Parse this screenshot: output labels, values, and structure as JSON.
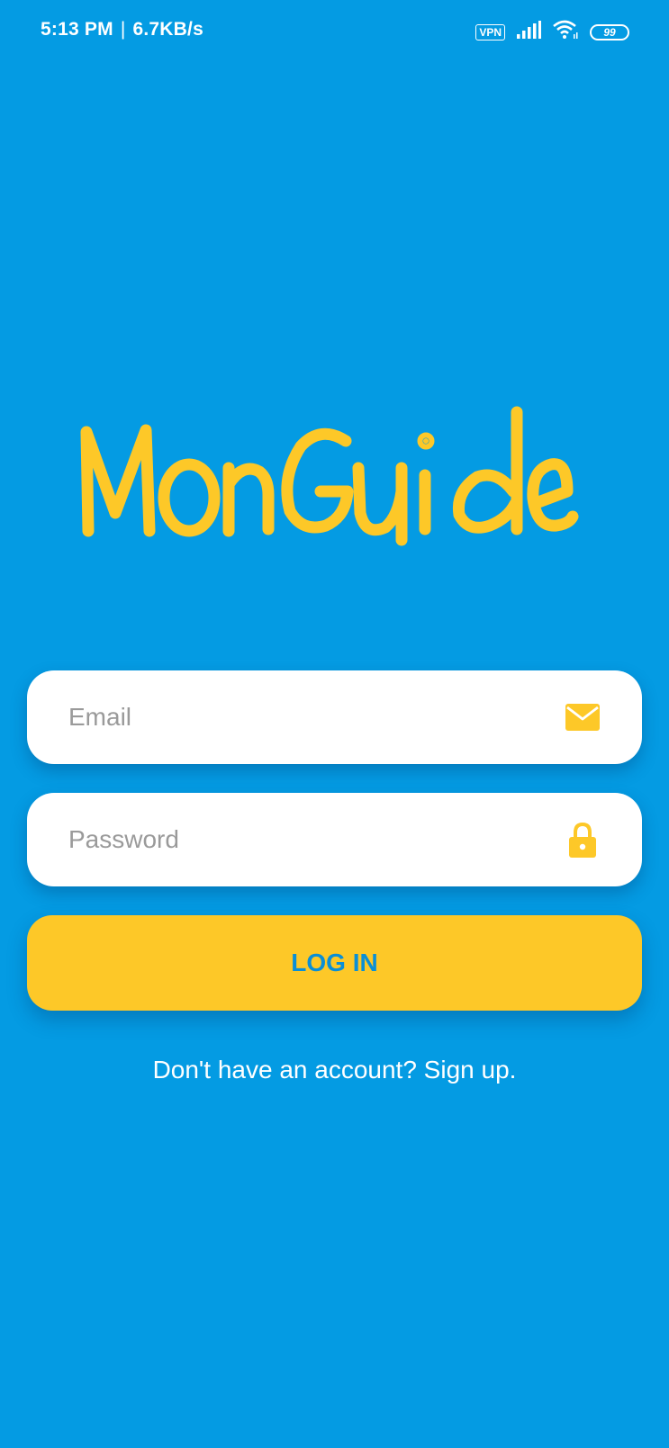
{
  "status_bar": {
    "time": "5:13 PM",
    "separator": "|",
    "network_speed": "6.7KB/s",
    "vpn_label": "VPN",
    "battery_level": "99"
  },
  "logo": {
    "text": "MonGuide",
    "color": "#fdc828"
  },
  "form": {
    "email": {
      "placeholder": "Email",
      "value": "",
      "icon": "envelope-icon"
    },
    "password": {
      "placeholder": "Password",
      "value": "",
      "icon": "lock-icon"
    },
    "login_label": "LOG IN",
    "signup_text": "Don't have an account? Sign up."
  },
  "colors": {
    "background": "#049be3",
    "accent": "#fdc828",
    "button_text": "#0a8fd6",
    "field_background": "#ffffff"
  }
}
